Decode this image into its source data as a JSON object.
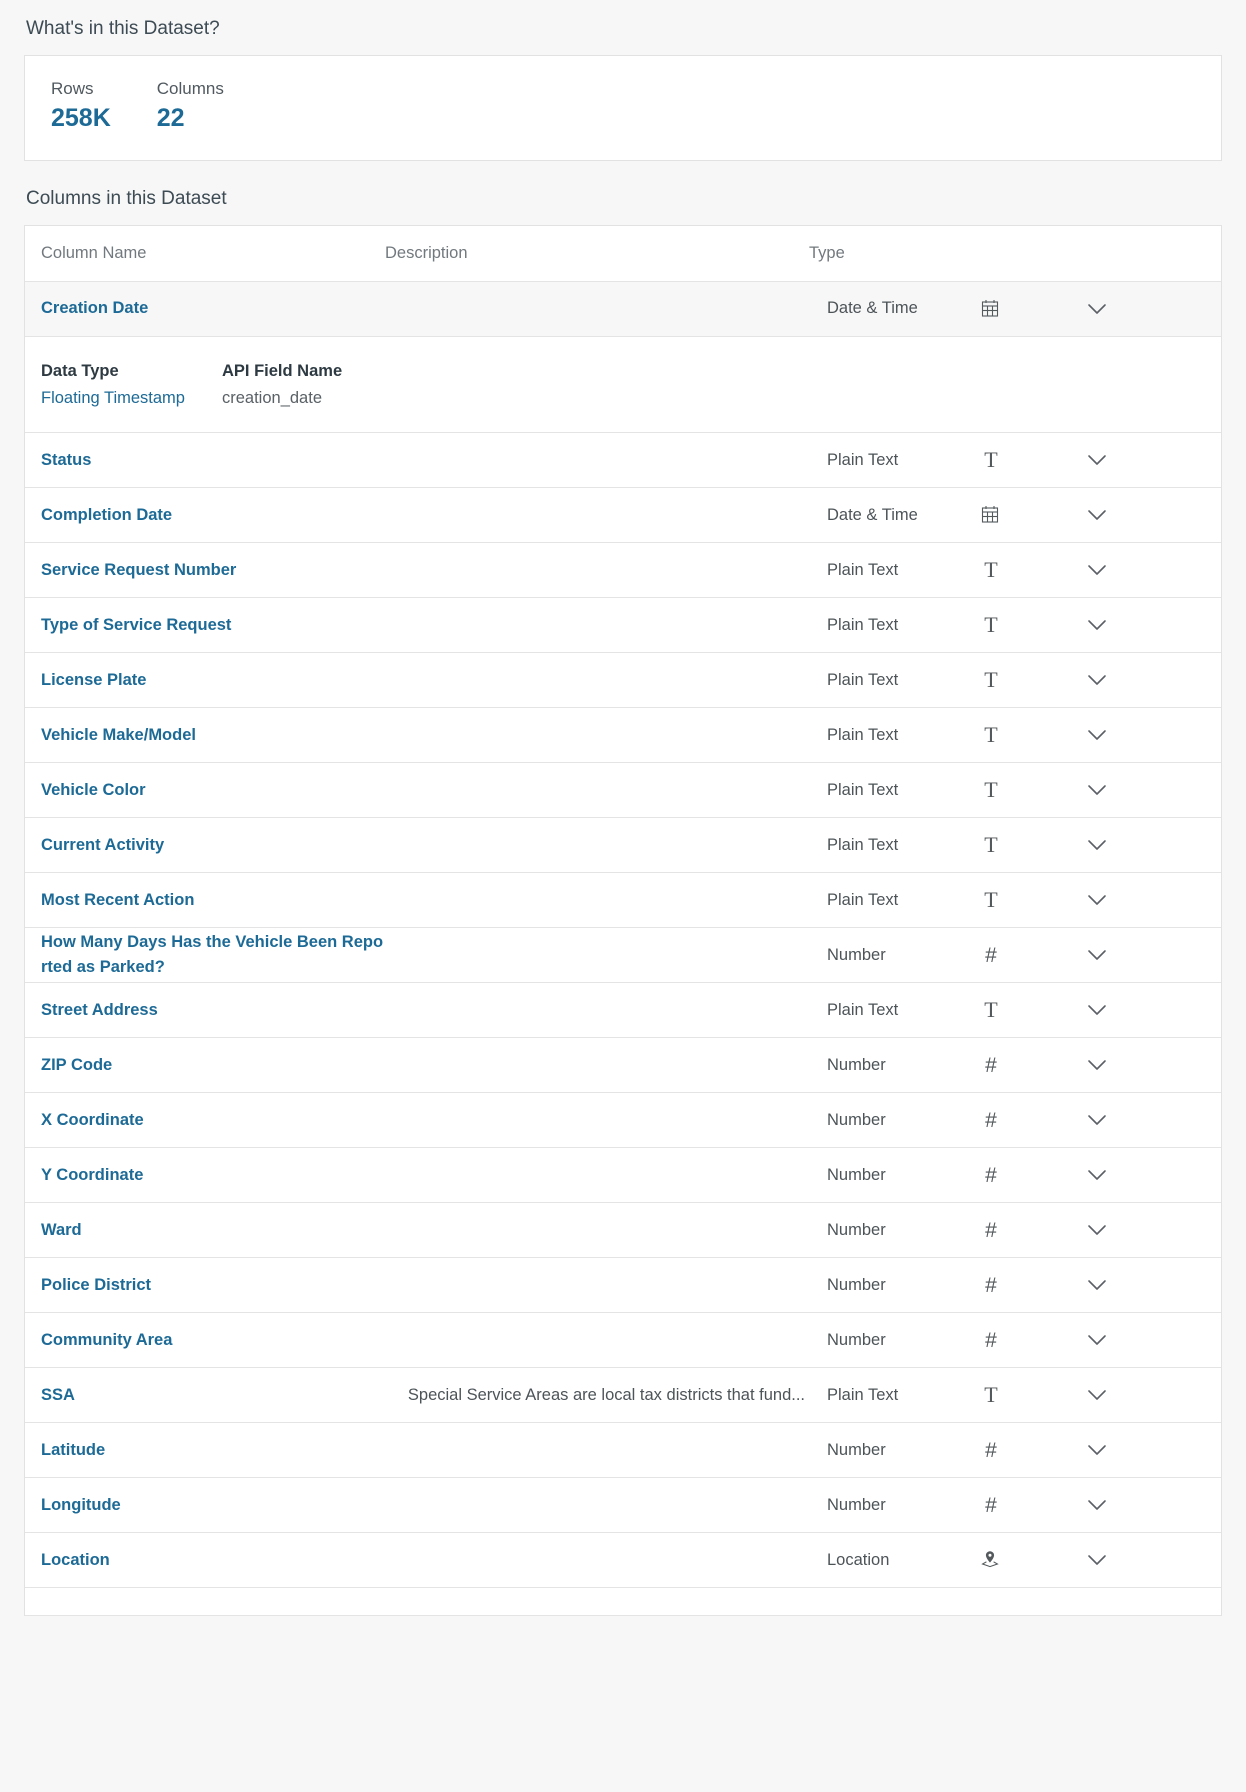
{
  "summary": {
    "heading": "What's in this Dataset?",
    "stats": [
      {
        "label": "Rows",
        "value": "258K"
      },
      {
        "label": "Columns",
        "value": "22"
      }
    ]
  },
  "columns_section": {
    "heading": "Columns in this Dataset",
    "table_headers": {
      "name": "Column Name",
      "description": "Description",
      "type": "Type"
    },
    "expanded_detail": {
      "data_type_label": "Data Type",
      "data_type_value": "Floating Timestamp",
      "api_field_label": "API Field Name",
      "api_field_value": "creation_date"
    },
    "rows": [
      {
        "name": "Creation Date",
        "description": "",
        "type": "Date & Time",
        "icon": "calendar-icon",
        "expanded": true
      },
      {
        "name": "Status",
        "description": "",
        "type": "Plain Text",
        "icon": "text-icon",
        "expanded": false
      },
      {
        "name": "Completion Date",
        "description": "",
        "type": "Date & Time",
        "icon": "calendar-icon",
        "expanded": false
      },
      {
        "name": "Service Request Number",
        "description": "",
        "type": "Plain Text",
        "icon": "text-icon",
        "expanded": false
      },
      {
        "name": "Type of Service Request",
        "description": "",
        "type": "Plain Text",
        "icon": "text-icon",
        "expanded": false
      },
      {
        "name": "License Plate",
        "description": "",
        "type": "Plain Text",
        "icon": "text-icon",
        "expanded": false
      },
      {
        "name": "Vehicle Make/Model",
        "description": "",
        "type": "Plain Text",
        "icon": "text-icon",
        "expanded": false
      },
      {
        "name": "Vehicle Color",
        "description": "",
        "type": "Plain Text",
        "icon": "text-icon",
        "expanded": false
      },
      {
        "name": "Current Activity",
        "description": "",
        "type": "Plain Text",
        "icon": "text-icon",
        "expanded": false
      },
      {
        "name": "Most Recent Action",
        "description": "",
        "type": "Plain Text",
        "icon": "text-icon",
        "expanded": false
      },
      {
        "name": "How Many Days Has the Vehicle Been Reported as Parked?",
        "description": "",
        "type": "Number",
        "icon": "number-icon",
        "expanded": false
      },
      {
        "name": "Street Address",
        "description": "",
        "type": "Plain Text",
        "icon": "text-icon",
        "expanded": false
      },
      {
        "name": "ZIP Code",
        "description": "",
        "type": "Number",
        "icon": "number-icon",
        "expanded": false
      },
      {
        "name": "X Coordinate",
        "description": "",
        "type": "Number",
        "icon": "number-icon",
        "expanded": false
      },
      {
        "name": "Y Coordinate",
        "description": "",
        "type": "Number",
        "icon": "number-icon",
        "expanded": false
      },
      {
        "name": "Ward",
        "description": "",
        "type": "Number",
        "icon": "number-icon",
        "expanded": false
      },
      {
        "name": "Police District",
        "description": "",
        "type": "Number",
        "icon": "number-icon",
        "expanded": false
      },
      {
        "name": "Community Area",
        "description": "",
        "type": "Number",
        "icon": "number-icon",
        "expanded": false
      },
      {
        "name": "SSA",
        "description": "Special Service Areas are local tax districts that fund...",
        "type": "Plain Text",
        "icon": "text-icon",
        "expanded": false
      },
      {
        "name": "Latitude",
        "description": "",
        "type": "Number",
        "icon": "number-icon",
        "expanded": false
      },
      {
        "name": "Longitude",
        "description": "",
        "type": "Number",
        "icon": "number-icon",
        "expanded": false
      },
      {
        "name": "Location",
        "description": "",
        "type": "Location",
        "icon": "location-pin-icon",
        "expanded": false
      }
    ]
  },
  "colors": {
    "link": "#1d6a96",
    "page_background": "#f7f7f7",
    "card_background": "#ffffff",
    "border": "#e4e4e4"
  }
}
